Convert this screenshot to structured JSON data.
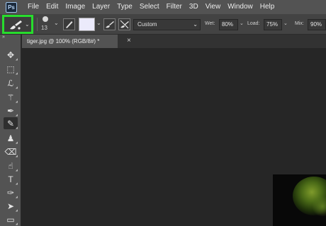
{
  "menubar": {
    "logo": "Ps",
    "items": [
      "File",
      "Edit",
      "Image",
      "Layer",
      "Type",
      "Select",
      "Filter",
      "3D",
      "View",
      "Window",
      "Help"
    ]
  },
  "options": {
    "brush_size": "13",
    "mode": "Custom",
    "wet_label": "Wet:",
    "wet_value": "80%",
    "load_label": "Load:",
    "load_value": "75%",
    "mix_label": "Mix:",
    "mix_value": "90%",
    "swatch_color": "#ebeafb",
    "highlight_color": "#27dd2d"
  },
  "toolbar": {
    "collapse": "»",
    "tools": [
      {
        "name": "move-tool",
        "icon": "move-icon",
        "glyph": "✥"
      },
      {
        "name": "marquee-tool",
        "icon": "rectangular-marquee-icon",
        "glyph": "⬚"
      },
      {
        "name": "lasso-tool",
        "icon": "lasso-icon",
        "glyph": "ℒ"
      },
      {
        "name": "quick-selection-tool",
        "icon": "magic-wand-icon",
        "glyph": "⚚"
      },
      {
        "name": "eyedropper-tool",
        "icon": "eyedropper-icon",
        "glyph": "✒"
      },
      {
        "name": "mixer-brush-tool",
        "icon": "mixer-brush-icon",
        "glyph": "✎"
      },
      {
        "name": "clone-stamp-tool",
        "icon": "stamp-icon",
        "glyph": "♟"
      },
      {
        "name": "eraser-tool",
        "icon": "eraser-icon",
        "glyph": "⌫"
      },
      {
        "name": "smudge-tool",
        "icon": "smudge-icon",
        "glyph": "☝"
      },
      {
        "name": "type-tool",
        "icon": "type-icon",
        "glyph": "T"
      },
      {
        "name": "pen-tool",
        "icon": "pen-icon",
        "glyph": "✑"
      },
      {
        "name": "path-selection-tool",
        "icon": "arrow-icon",
        "glyph": "➤"
      },
      {
        "name": "rectangle-tool",
        "icon": "rectangle-icon",
        "glyph": "▭"
      }
    ]
  },
  "document": {
    "tab_title": "tiger.jpg @ 100% (RGB/8#) *",
    "close": "×"
  }
}
